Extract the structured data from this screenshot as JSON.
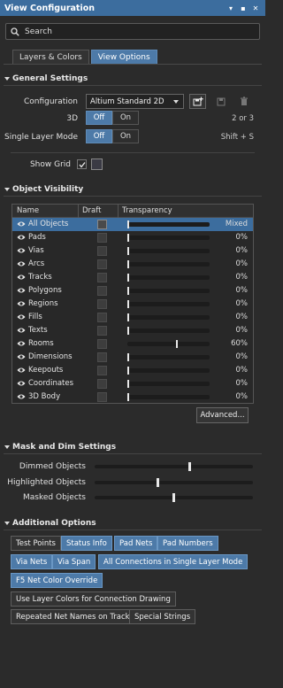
{
  "window": {
    "title": "View Configuration"
  },
  "search": {
    "placeholder": "Search"
  },
  "tabs": [
    {
      "label": "Layers & Colors",
      "active": false
    },
    {
      "label": "View Options",
      "active": true
    }
  ],
  "general": {
    "heading": "General Settings",
    "configuration_label": "Configuration",
    "configuration_value": "Altium Standard 2D",
    "three_d_label": "3D",
    "three_d_options": [
      "Off",
      "On"
    ],
    "three_d_selected": "Off",
    "three_d_shortcut": "2 or 3",
    "single_layer_label": "Single Layer Mode",
    "single_layer_options": [
      "Off",
      "On"
    ],
    "single_layer_selected": "Off",
    "single_layer_shortcut": "Shift + S",
    "show_grid_label": "Show Grid",
    "show_grid_checked": true
  },
  "visibility": {
    "heading": "Object Visibility",
    "columns": [
      "Name",
      "Draft",
      "Transparency"
    ],
    "rows": [
      {
        "name": "All Objects",
        "value": "Mixed",
        "level": 0,
        "selected": true
      },
      {
        "name": "Pads",
        "value": "0%",
        "level": 0
      },
      {
        "name": "Vias",
        "value": "0%",
        "level": 0
      },
      {
        "name": "Arcs",
        "value": "0%",
        "level": 0
      },
      {
        "name": "Tracks",
        "value": "0%",
        "level": 0
      },
      {
        "name": "Polygons",
        "value": "0%",
        "level": 0
      },
      {
        "name": "Regions",
        "value": "0%",
        "level": 0
      },
      {
        "name": "Fills",
        "value": "0%",
        "level": 0
      },
      {
        "name": "Texts",
        "value": "0%",
        "level": 0
      },
      {
        "name": "Rooms",
        "value": "60%",
        "level": 0.6
      },
      {
        "name": "Dimensions",
        "value": "0%",
        "level": 0
      },
      {
        "name": "Keepouts",
        "value": "0%",
        "level": 0
      },
      {
        "name": "Coordinates",
        "value": "0%",
        "level": 0
      },
      {
        "name": "3D Body",
        "value": "0%",
        "level": 0
      }
    ],
    "advanced_label": "Advanced..."
  },
  "mask": {
    "heading": "Mask and Dim Settings",
    "items": [
      {
        "label": "Dimmed Objects",
        "level": 0.6
      },
      {
        "label": "Highlighted Objects",
        "level": 0.4
      },
      {
        "label": "Masked Objects",
        "level": 0.5
      }
    ]
  },
  "additional": {
    "heading": "Additional Options",
    "buttons": [
      {
        "label": "Test Points",
        "on": false
      },
      {
        "label": "Status Info",
        "on": true
      },
      {
        "label": "Pad Nets",
        "on": true
      },
      {
        "label": "Pad Numbers",
        "on": true
      },
      {
        "label": "Via Nets",
        "on": true
      },
      {
        "label": "Via Span",
        "on": true
      },
      {
        "label": "All Connections in Single Layer Mode",
        "on": true
      },
      {
        "label": "F5  Net Color Override",
        "on": true
      },
      {
        "label": "Use Layer Colors for Connection Drawing",
        "on": false
      },
      {
        "label": "Repeated Net Names on Tracks",
        "on": false
      },
      {
        "label": "Special Strings",
        "on": false
      }
    ]
  },
  "colors": {
    "accent": "#4d7aa8",
    "titlebar": "#3c6d9e",
    "background": "#2b2b2b"
  }
}
